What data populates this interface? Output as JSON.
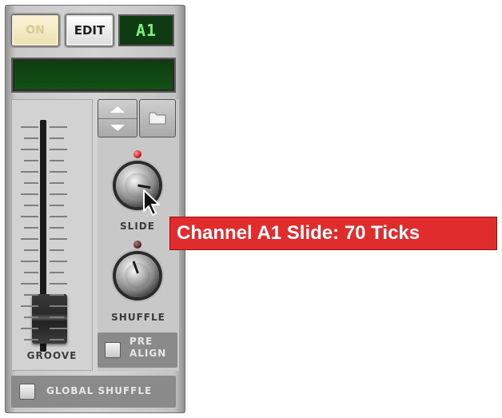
{
  "device": {
    "on_label": "ON",
    "edit_label": "EDIT",
    "pattern_display": "A1",
    "groove_label": "GROOVE",
    "slide_label": "SLIDE",
    "shuffle_label": "SHUFFLE",
    "prealign_label_line1": "PRE",
    "prealign_label_line2": "ALIGN",
    "global_shuffle_label": "GLOBAL SHUFFLE"
  },
  "tooltip": {
    "text": "Channel A1 Slide: 70 Ticks"
  },
  "colors": {
    "tooltip_bg": "#e02c2c",
    "display_green": "#0f3a12",
    "display_text": "#7cf07a",
    "led_active": "#d21a1a"
  },
  "icons": {
    "up_arrow": "up-arrow-icon",
    "down_arrow": "down-arrow-icon",
    "folder": "folder-icon",
    "cursor": "mouse-pointer-icon"
  }
}
